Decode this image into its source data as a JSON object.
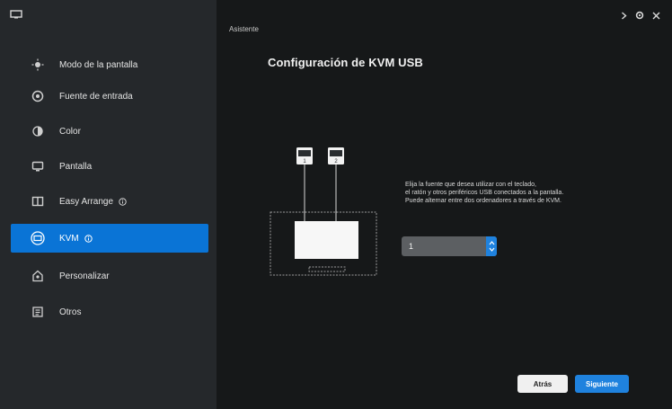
{
  "sidebar": {
    "items": [
      {
        "label": "Modo de la pantalla",
        "icon": "sun-icon"
      },
      {
        "label": "Fuente de entrada",
        "icon": "input-source-icon"
      },
      {
        "label": "Color",
        "icon": "color-icon"
      },
      {
        "label": "Pantalla",
        "icon": "display-icon"
      },
      {
        "label": "Easy Arrange",
        "icon": "easy-arrange-icon"
      },
      {
        "label": "KVM",
        "icon": "kvm-icon",
        "selected": true
      },
      {
        "label": "Personalizar",
        "icon": "personalize-icon"
      },
      {
        "label": "Otros",
        "icon": "others-icon"
      }
    ]
  },
  "header": {
    "breadcrumb": "Asistente",
    "title": "Configuración de KVM USB"
  },
  "diagram": {
    "port_labels": [
      "1",
      "2"
    ]
  },
  "content": {
    "description": [
      "Elija la fuente que desea utilizar con el teclado,",
      "el ratón y otros periféricos USB conectados a la pantalla.",
      "Puede alternar entre dos ordenadores a través de KVM."
    ],
    "select_value": "1"
  },
  "buttons": {
    "back": "Atrás",
    "next": "Siguiente"
  },
  "colors": {
    "accent": "#1f82de",
    "selected": "#0a74d6",
    "sidebar_bg": "#25282b",
    "main_bg": "#161819"
  }
}
